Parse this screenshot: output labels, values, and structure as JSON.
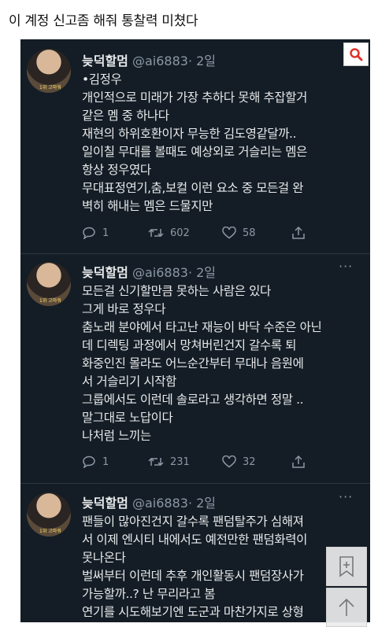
{
  "post_title": "이 계정 신고좀 해줘 통찰력 미쳤다",
  "tweets": [
    {
      "name": "늦덕할멈",
      "handle": "@ai6883",
      "time": "· 2일",
      "lines": [
        "•김정우",
        "개인적으로 미래가 가장 추하다 못해 추잡할거",
        "같은 멤 중 하나다",
        "재현의 하위호환이자 무능한 김도영같달까..",
        "일이칠 무대를 볼때도 예상외로 거슬리는 멤은",
        "항상 정우였다",
        "무대표정연기,춤,보컬 이런 요소 중 모든걸 완",
        "벽히 해내는 멤은 드물지만"
      ],
      "replies": "1",
      "retweets": "602",
      "likes": "58"
    },
    {
      "name": "늦덕할멈",
      "handle": "@ai6883",
      "time": "· 2일",
      "lines": [
        "모든걸 신기할만큼 못하는 사람은 있다",
        "그게 바로 정우다",
        "춤노래 분야에서 타고난 재능이 바닥 수준은 아닌",
        "데 디렉팅 과정에서 망쳐버린건지 갈수록 퇴",
        "화중인진 몰라도 어느순간부터 무대나 음원에",
        "서 거슬리기 시작함",
        "그룹에서도 이런데 솔로라고 생각하면 정말 ..",
        "말그대로 노답이다",
        "나처럼 느끼는"
      ],
      "replies": "1",
      "retweets": "231",
      "likes": "32"
    },
    {
      "name": "늦덕할멈",
      "handle": "@ai6883",
      "time": "· 2일",
      "lines": [
        "팬들이 많아진건지 갈수록 팬덤탈주가 심해져",
        "서 이제 엔시티 내에서도 예전만한 팬덤화력이",
        "못나온다",
        "벌써부터 이런데 추후 개인활동시 팬덤장사가",
        "가능할까..? 난 무리라고 봄",
        "연기를 시도해보기엔 도군과 마찬가지로 상형"
      ]
    }
  ],
  "avatar_caption": "1위 고마워",
  "more_label": "···",
  "icons": {
    "search": "search-icon",
    "bookmark": "bookmark-icon",
    "scroll_top": "arrow-up-icon",
    "reply": "reply-icon",
    "retweet": "retweet-icon",
    "like": "heart-icon",
    "share": "share-icon"
  },
  "colors": {
    "background": "#141d26",
    "text": "#e7e9ea",
    "muted": "#8b98a5",
    "search_accent": "#e0342b"
  }
}
